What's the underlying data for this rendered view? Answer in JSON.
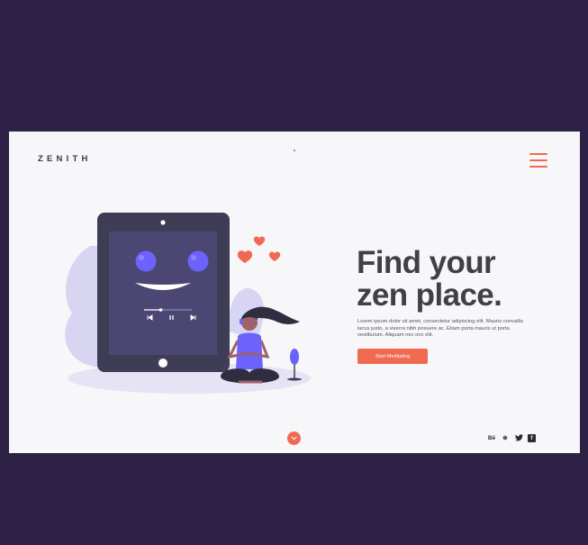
{
  "colors": {
    "page_background": "#2d2245",
    "card_background": "#f7f6f8",
    "accent": "#f06a52",
    "heading": "#404046",
    "purple": "#6c63ff"
  },
  "header": {
    "logo": "ZENITH",
    "menu_icon": "hamburger-menu-icon"
  },
  "hero": {
    "headline_line1": "Find your",
    "headline_line2": "zen place.",
    "body": "Lorem ipsum dolor sit amet, consectetur adipiscing elit. Mauris convallis lacus justo, a viverra nibh posuere ac. Etiam porta mauris ut porta vestibulum. Aliquam nec orci elit.",
    "cta_label": "Start Meditating"
  },
  "illustration": {
    "name": "meditation-tablet-illustration",
    "player_icons": [
      "previous-icon",
      "pause-icon",
      "next-icon"
    ],
    "progress": 0.35
  },
  "footer": {
    "scroll_icon": "chevron-down-icon",
    "social": [
      {
        "name": "behance-icon",
        "glyph": "Bē"
      },
      {
        "name": "dribbble-icon",
        "glyph": "⊛"
      },
      {
        "name": "twitter-icon",
        "glyph": "🐦"
      },
      {
        "name": "facebook-icon",
        "glyph": "f"
      }
    ]
  }
}
